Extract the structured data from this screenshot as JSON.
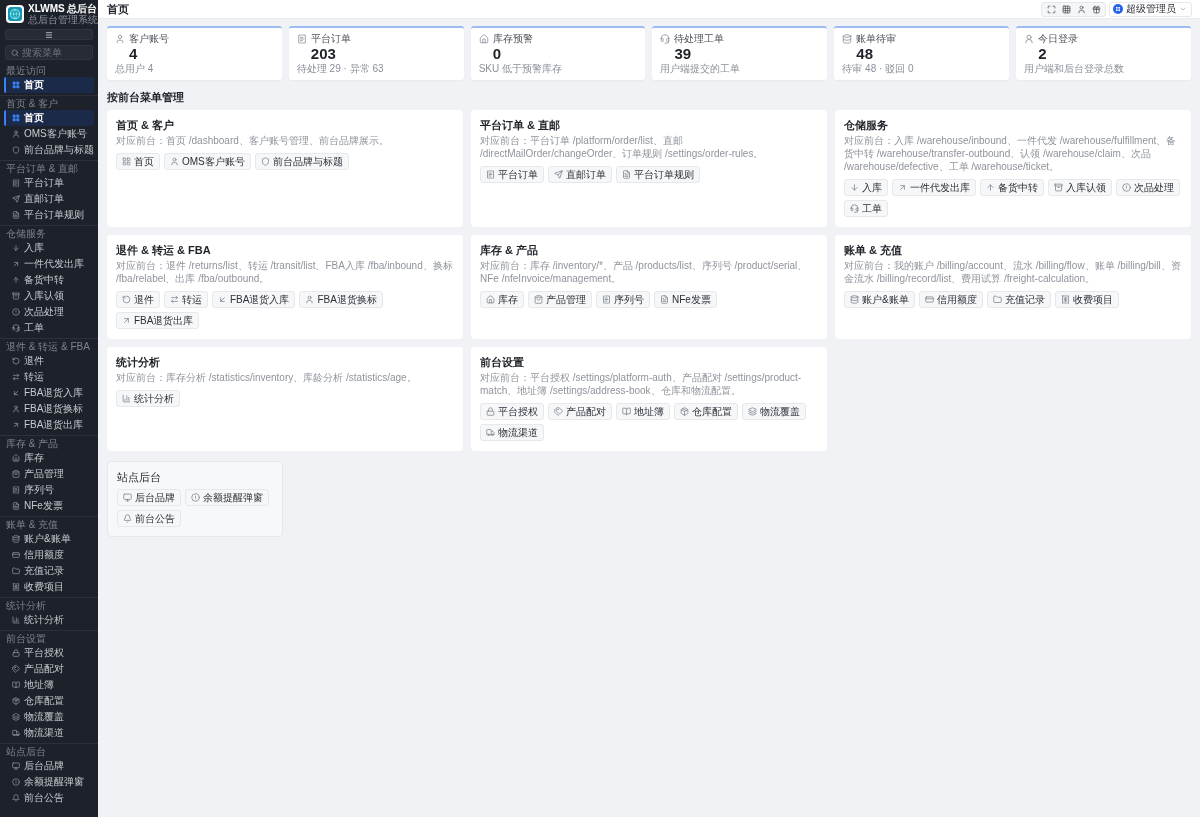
{
  "sidebar": {
    "brand": {
      "title": "XLWMS 总后台",
      "subtitle": "总后台管理系统"
    },
    "search": {
      "placeholder": "搜索菜单"
    },
    "groups": [
      {
        "label": "最近访问",
        "items": [
          {
            "label": "首页",
            "selected": true
          }
        ]
      },
      {
        "label": "首页 & 客户",
        "items": [
          {
            "label": "首页",
            "selected": true
          },
          {
            "label": "OMS客户账号",
            "selected": false
          },
          {
            "label": "前台品牌与标题",
            "selected": false
          }
        ]
      },
      {
        "label": "平台订单 & 直邮",
        "items": [
          {
            "label": "平台订单",
            "selected": false
          },
          {
            "label": "直邮订单",
            "selected": false
          },
          {
            "label": "平台订单规则",
            "selected": false
          }
        ]
      },
      {
        "label": "仓储服务",
        "items": [
          {
            "label": "入库",
            "selected": false
          },
          {
            "label": "一件代发出库",
            "selected": false
          },
          {
            "label": "备货中转",
            "selected": false
          },
          {
            "label": "入库认领",
            "selected": false
          },
          {
            "label": "次品处理",
            "selected": false
          },
          {
            "label": "工单",
            "selected": false
          }
        ]
      },
      {
        "label": "退件 & 转运 & FBA",
        "items": [
          {
            "label": "退件",
            "selected": false
          },
          {
            "label": "转运",
            "selected": false
          },
          {
            "label": "FBA退货入库",
            "selected": false
          },
          {
            "label": "FBA退货换标",
            "selected": false
          },
          {
            "label": "FBA退货出库",
            "selected": false
          }
        ]
      },
      {
        "label": "库存 & 产品",
        "items": [
          {
            "label": "库存",
            "selected": false
          },
          {
            "label": "产品管理",
            "selected": false
          },
          {
            "label": "序列号",
            "selected": false
          },
          {
            "label": "NFe发票",
            "selected": false
          }
        ]
      },
      {
        "label": "账单 & 充值",
        "items": [
          {
            "label": "账户&账单",
            "selected": false
          },
          {
            "label": "信用额度",
            "selected": false
          },
          {
            "label": "充值记录",
            "selected": false
          },
          {
            "label": "收费项目",
            "selected": false
          }
        ]
      },
      {
        "label": "统计分析",
        "items": [
          {
            "label": "统计分析",
            "selected": false
          }
        ]
      },
      {
        "label": "前台设置",
        "items": [
          {
            "label": "平台授权",
            "selected": false
          },
          {
            "label": "产品配对",
            "selected": false
          },
          {
            "label": "地址簿",
            "selected": false
          },
          {
            "label": "仓库配置",
            "selected": false
          },
          {
            "label": "物流覆盖",
            "selected": false
          },
          {
            "label": "物流渠道",
            "selected": false
          }
        ]
      },
      {
        "label": "站点后台",
        "items": [
          {
            "label": "后台品牌",
            "selected": false
          },
          {
            "label": "余额提醒弹窗",
            "selected": false
          },
          {
            "label": "前台公告",
            "selected": false
          }
        ]
      }
    ]
  },
  "header": {
    "title": "首页",
    "user": {
      "name": "超级管理员"
    }
  },
  "stats": [
    {
      "label": "客户账号",
      "value": "4",
      "note": "总用户 4"
    },
    {
      "label": "平台订单",
      "value": "203",
      "note": "待处理 29 · 异常 63"
    },
    {
      "label": "库存预警",
      "value": "0",
      "note": "SKU 低于预警库存"
    },
    {
      "label": "待处理工单",
      "value": "39",
      "note": "用户端提交的工单"
    },
    {
      "label": "账单待审",
      "value": "48",
      "note": "待审 48 · 驳回 0"
    },
    {
      "label": "今日登录",
      "value": "2",
      "note": "用户端和后台登录总数"
    }
  ],
  "section": {
    "title": "按前台菜单管理"
  },
  "modules": [
    {
      "kind": "full",
      "title": "首页 & 客户",
      "description": "对应前台：首页 /dashboard、客户账号管理、前台品牌展示。",
      "links": [
        "首页",
        "OMS客户账号",
        "前台品牌与标题"
      ]
    },
    {
      "kind": "full",
      "title": "平台订单 & 直邮",
      "description": "对应前台：平台订单 /platform/order/list、直邮 /directMailOrder/changeOrder、订单规则 /settings/order-rules。",
      "links": [
        "平台订单",
        "直邮订单",
        "平台订单规则"
      ]
    },
    {
      "kind": "full",
      "title": "仓储服务",
      "description": "对应前台：入库 /warehouse/inbound、一件代发 /warehouse/fulfillment、备货中转 /warehouse/transfer-outbound、认领 /warehouse/claim、次品 /warehouse/defective、工单 /warehouse/ticket。",
      "links": [
        "入库",
        "一件代发出库",
        "备货中转",
        "入库认领",
        "次品处理",
        "工单"
      ]
    },
    {
      "kind": "full",
      "title": "退件 & 转运 & FBA",
      "description": "对应前台：退件 /returns/list、转运 /transit/list、FBA入库 /fba/inbound、换标 /fba/relabel、出库 /fba/outbound。",
      "links": [
        "退件",
        "转运",
        "FBA退货入库",
        "FBA退货换标",
        "FBA退货出库"
      ]
    },
    {
      "kind": "full",
      "title": "库存 & 产品",
      "description": "对应前台：库存 /inventory/*、产品 /products/list、序列号 /product/serial、NFe /nfeInvoice/management。",
      "links": [
        "库存",
        "产品管理",
        "序列号",
        "NFe发票"
      ]
    },
    {
      "kind": "full",
      "title": "账单 & 充值",
      "description": "对应前台：我的账户 /billing/account、流水 /billing/flow、账单 /billing/bill、资金流水 /billing/record/list、费用试算 /freight-calculation。",
      "links": [
        "账户&账单",
        "信用额度",
        "充值记录",
        "收费项目"
      ]
    },
    {
      "kind": "full",
      "title": "统计分析",
      "description": "对应前台：库存分析 /statistics/inventory、库龄分析 /statistics/age。",
      "links": [
        "统计分析"
      ]
    },
    {
      "kind": "full",
      "title": "前台设置",
      "description": "对应前台：平台授权 /settings/platform-auth、产品配对 /settings/product-match、地址簿 /settings/address-book、仓库和物流配置。",
      "links": [
        "平台授权",
        "产品配对",
        "地址簿",
        "仓库配置",
        "物流覆盖",
        "物流渠道"
      ]
    },
    {
      "kind": "compact",
      "title": "站点后台",
      "links": [
        "后台品牌",
        "余额提醒弹窗",
        "前台公告"
      ]
    }
  ]
}
